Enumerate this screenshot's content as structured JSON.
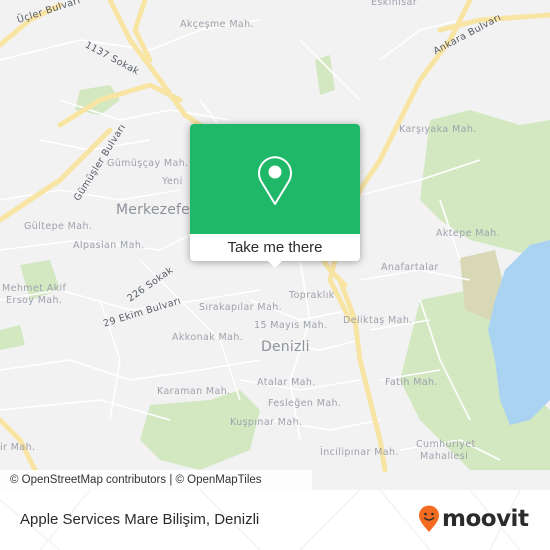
{
  "map": {
    "labels": {
      "ucler_bulvari": "Üçler Bulvarı",
      "akcesme": "Akçeşme Mah.",
      "eskihisar": "Eskihisar",
      "ankara_bulvari": "Ankara Bulvarı",
      "sokak_1137": "1137 Sokak",
      "gumuser_bulvari": "Gümüşler Bulvarı",
      "gumuscay": "Gümüşçay Mah.",
      "yeni": "Yeni",
      "merkezefendi": "Merkezefendi",
      "gultepe": "Gültepe Mah.",
      "alpaslan": "Alpaslan Mah.",
      "mehmet_akif_1": "Mehmet Akif",
      "mehmet_akif_2": "Ersoy Mah.",
      "sokak_226": "226 Sokak",
      "ekim_29": "29 Ekim Bulvarı",
      "karsiyaka": "Karşıyaka Mah.",
      "aktepe": "Aktepe Mah.",
      "anafartalar": "Anafartalar",
      "topraklik": "Topraklık",
      "sirakapilar": "Sırakapılar Mah.",
      "mayis_15": "15 Mayıs Mah.",
      "deliktas": "Deliktaş Mah.",
      "akkonak": "Akkonak Mah.",
      "denizli": "Denizli",
      "fatih": "Fatih Mah.",
      "karaman": "Karaman Mah.",
      "atalar": "Atalar Mah.",
      "feslegen": "Fesleğen Mah.",
      "kuspinar": "Kuşpınar Mah.",
      "incilipinar": "İncilipınar Mah.",
      "cumhuriyet_1": "Cumhuriyet",
      "cumhuriyet_2": "Mahallesi",
      "sir_mah": "ir Mah."
    },
    "colors": {
      "background": "#f2f2f3",
      "major_road": "#f7e3a1",
      "park": "#cfe6b8",
      "water": "#a8d4f2",
      "popup_green": "#1fb868"
    }
  },
  "popup": {
    "icon": "location-pin-icon",
    "cta_label": "Take me there"
  },
  "attribution": "© OpenStreetMap contributors | © OpenMapTiles",
  "footer": {
    "place_title": "Apple Services Mare Bilişim, Denizli",
    "brand_name": "moovit",
    "brand_color": "#f26b21"
  }
}
